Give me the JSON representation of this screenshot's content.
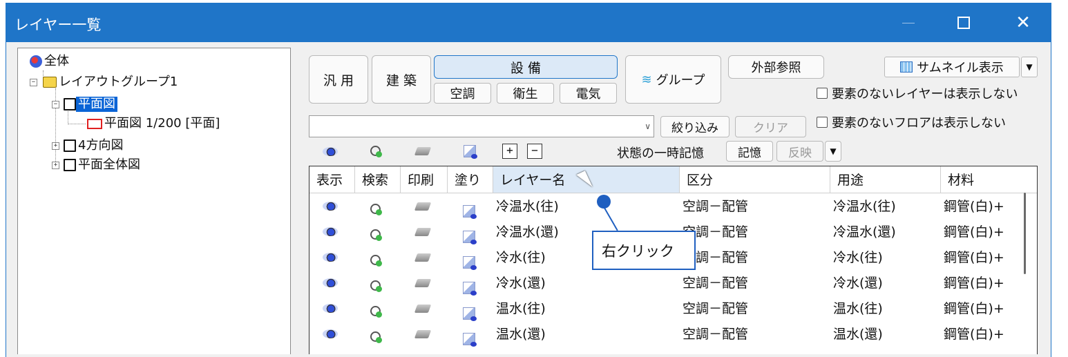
{
  "window": {
    "title": "レイヤー一覧",
    "accent": "#1f75c8"
  },
  "tree": {
    "root": "全体",
    "group": "レイアウトグループ1",
    "items": [
      {
        "label": "平面図",
        "selected": true
      },
      {
        "label": "平面図 1/200 [平面]"
      },
      {
        "label": "4方向図"
      },
      {
        "label": "平面全体図"
      }
    ]
  },
  "toolbar": {
    "general": "汎 用",
    "architecture": "建 築",
    "equipment": "設 備",
    "hvac": "空調",
    "sanitary": "衛生",
    "electric": "電気",
    "group": "グループ",
    "external_ref": "外部参照",
    "thumbnail": "サムネイル表示",
    "hide_empty_layers": "要素のないレイヤーは表示しない",
    "hide_empty_floors": "要素のないフロアは表示しない",
    "narrow": "絞り込み",
    "clear": "クリア",
    "state_memory_label": "状態の一時記憶",
    "memory": "記憶",
    "apply": "反映"
  },
  "grid": {
    "headers": [
      "表示",
      "検索",
      "印刷",
      "塗り",
      "レイヤー名",
      "区分",
      "用途",
      "材料"
    ],
    "rows": [
      {
        "name": "冷温水(往)",
        "category": "空調－配管",
        "use": "冷温水(往)",
        "material": "鋼管(白)+"
      },
      {
        "name": "冷温水(還)",
        "category": "空調－配管",
        "use": "冷温水(還)",
        "material": "鋼管(白)+"
      },
      {
        "name": "冷水(往)",
        "category": "空調－配管",
        "use": "冷水(往)",
        "material": "鋼管(白)+"
      },
      {
        "name": "冷水(還)",
        "category": "空調－配管",
        "use": "冷水(還)",
        "material": "鋼管(白)+"
      },
      {
        "name": "温水(往)",
        "category": "空調－配管",
        "use": "温水(往)",
        "material": "鋼管(白)+"
      },
      {
        "name": "温水(還)",
        "category": "空調－配管",
        "use": "温水(還)",
        "material": "鋼管(白)+"
      }
    ]
  },
  "callout": {
    "text": "右クリック"
  }
}
